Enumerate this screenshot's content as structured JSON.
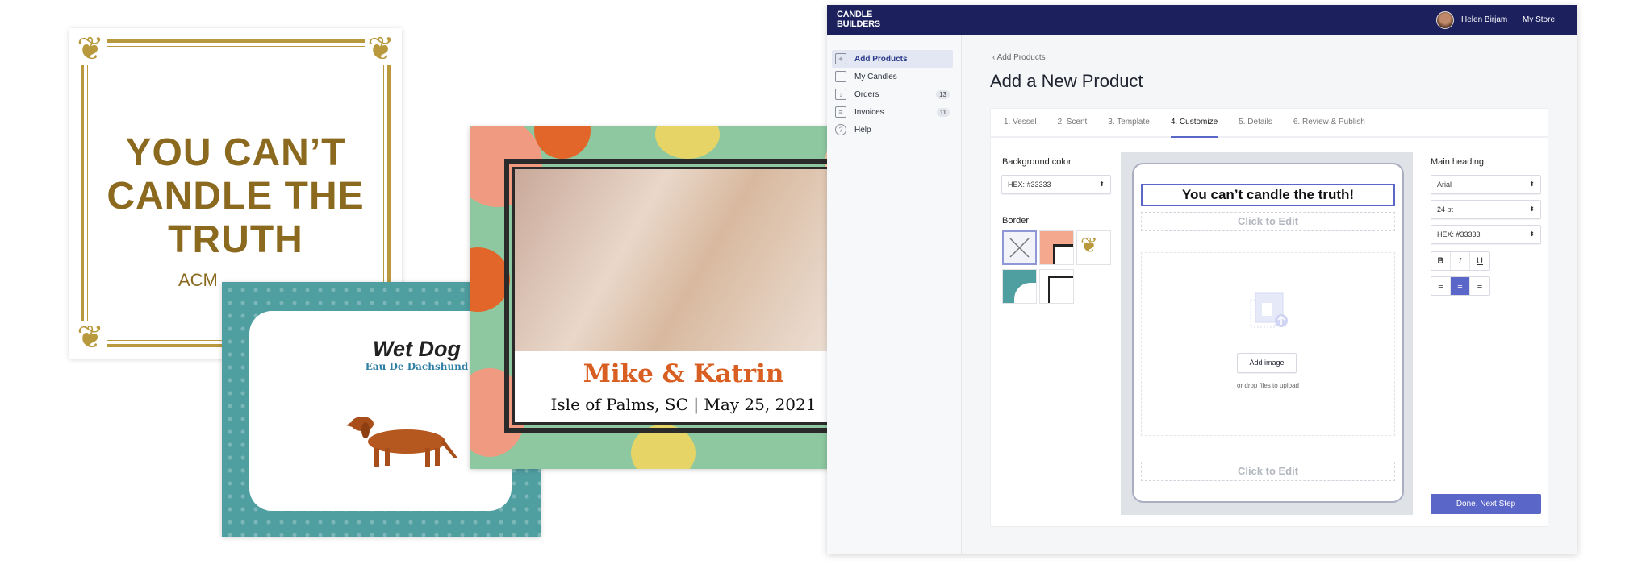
{
  "samples": {
    "gold_label": {
      "title_line1": "YOU CAN’T",
      "title_line2": "CANDLE THE TRUTH",
      "footer_partial": "ACM",
      "accent": "#b8993e",
      "text_color": "#8b6a1f"
    },
    "teal_label": {
      "title": "Wet Dog",
      "subtitle": "Eau De Dachshund",
      "background": "#4f9ea0",
      "subtitle_color": "#2f7fa5"
    },
    "floral_label": {
      "names": "Mike & Katrin",
      "details": "Isle of Palms, SC  |  May 25, 2021",
      "names_color": "#d85f21"
    }
  },
  "app": {
    "header": {
      "logo": "CANDLE BUILDERS",
      "user_name": "Helen Birjam",
      "store_menu": "My Store",
      "background": "#1c215e"
    },
    "sidebar": {
      "items": [
        {
          "label": "Add Products",
          "icon": "add-product-icon",
          "active": true
        },
        {
          "label": "My Candles",
          "icon": "candle-icon"
        },
        {
          "label": "Orders",
          "icon": "inbox-icon",
          "badge": "13"
        },
        {
          "label": "Invoices",
          "icon": "invoice-icon",
          "badge": "11"
        },
        {
          "label": "Help",
          "icon": "help-icon"
        }
      ]
    },
    "breadcrumb": "Add Products",
    "page_title": "Add a New Product",
    "tabs": [
      {
        "label": "1. Vessel"
      },
      {
        "label": "2. Scent"
      },
      {
        "label": "3. Template"
      },
      {
        "label": "4. Customize",
        "active": true
      },
      {
        "label": "5. Details"
      },
      {
        "label": "6. Review & Publish"
      }
    ],
    "left": {
      "bg_label": "Background color",
      "bg_value": "HEX: #33333",
      "border_label": "Border"
    },
    "preview": {
      "heading": "You can’t candle the truth!",
      "click_to_edit": "Click to Edit",
      "add_image": "Add image",
      "drop_hint": "or drop files to upload"
    },
    "right": {
      "label": "Main heading",
      "font": "Arial",
      "size": "24 pt",
      "color": "HEX: #33333",
      "format": [
        "B",
        "I",
        "U"
      ],
      "align_selected": "center"
    },
    "next_button": "Done, Next Step",
    "accent": "#5a66c8"
  }
}
